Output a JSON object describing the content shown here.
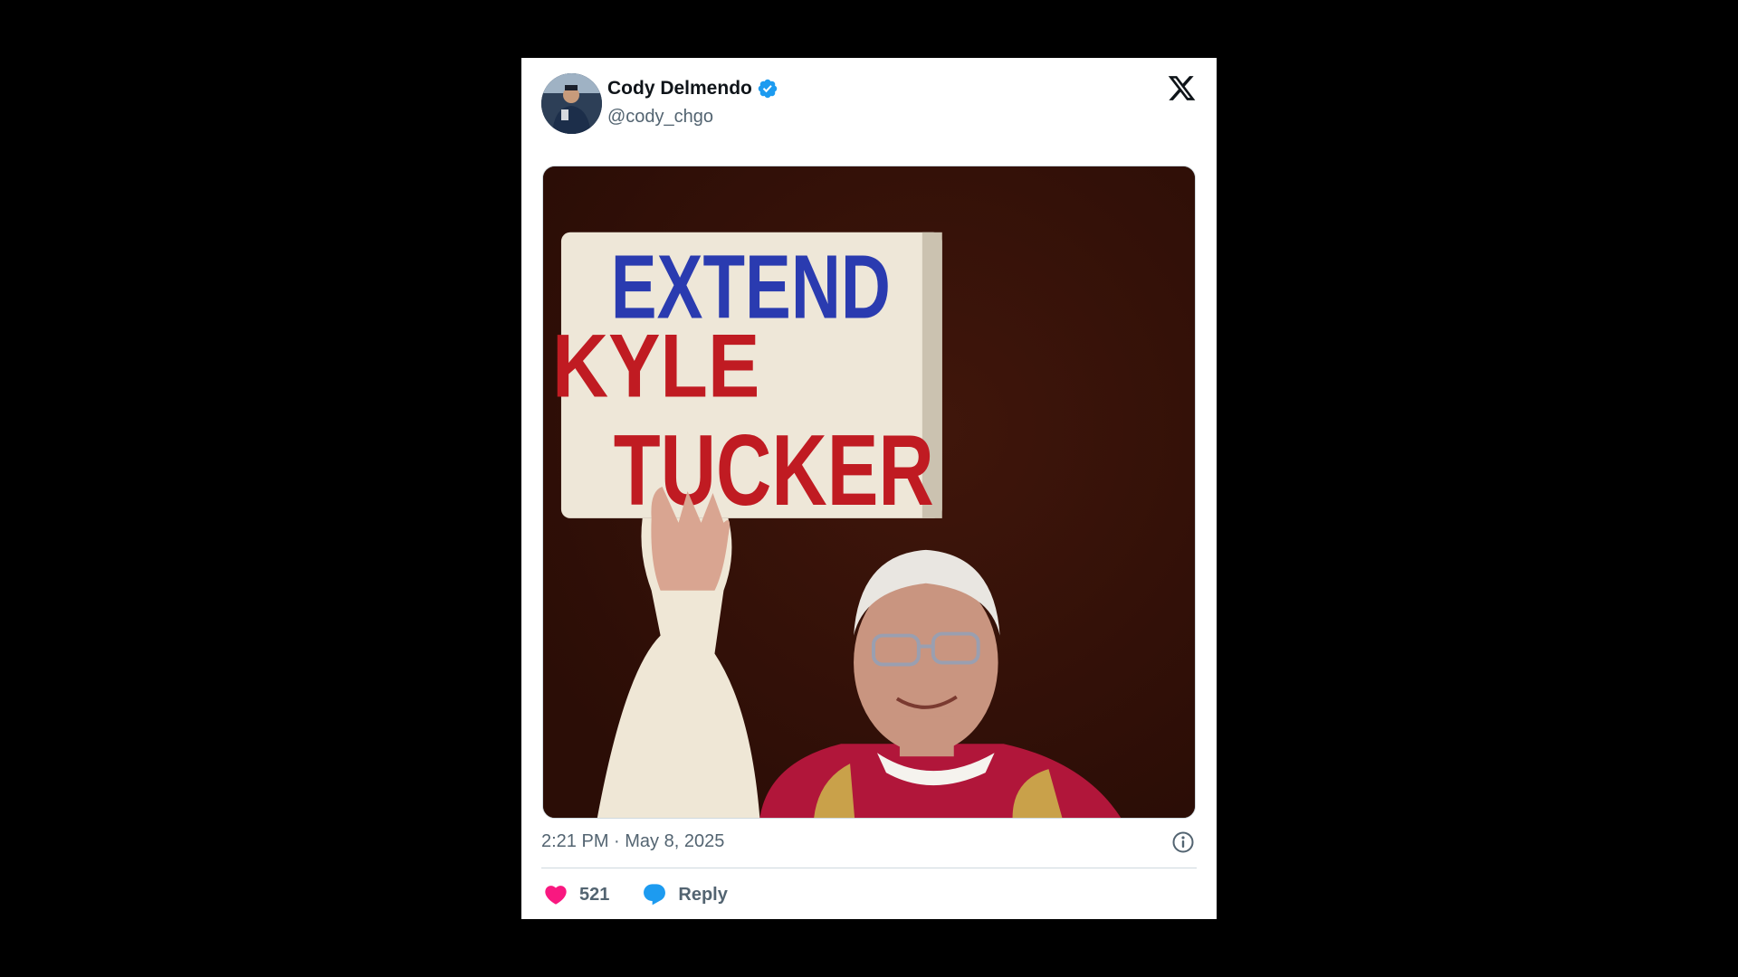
{
  "tweet": {
    "author": {
      "display_name": "Cody Delmendo",
      "handle": "@cody_chgo",
      "verified": true
    },
    "brand_icon": "x-logo-icon",
    "media": {
      "sign_lines": [
        "EXTEND",
        "KYLE",
        "TUCKER"
      ]
    },
    "timestamp": "2:21 PM · May 8, 2025",
    "actions": {
      "likes_count": "521",
      "reply_label": "Reply"
    }
  },
  "colors": {
    "heart": "#f91880",
    "reply_bubble": "#1d9bf0",
    "verified": "#1d9bf0",
    "text_secondary": "#536471"
  }
}
